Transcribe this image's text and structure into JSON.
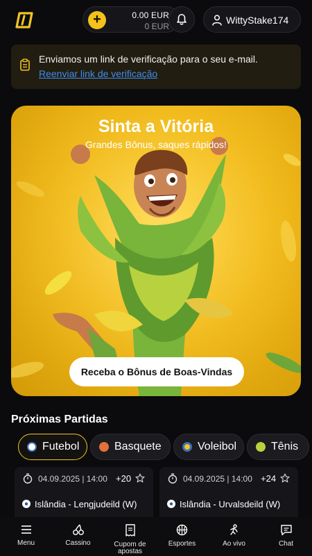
{
  "header": {
    "balance_main": "0.00 EUR",
    "balance_sub": "0 EUR",
    "coin_symbol": "+",
    "username": "WittyStake174"
  },
  "verify": {
    "message": "Enviamos um link de verificação para o seu e-mail.",
    "link": "Reenviar link de verificação"
  },
  "hero": {
    "title": "Sinta a Vitória",
    "subtitle": "Grandes Bônus, saques rápidos!",
    "cta": "Receba o Bônus de Boas-Vindas"
  },
  "matches": {
    "title": "Próximas Partidas",
    "sports": [
      {
        "label": "Futebol",
        "icon": "soccer-ball-icon",
        "active": true
      },
      {
        "label": "Basquete",
        "icon": "basketball-icon",
        "active": false
      },
      {
        "label": "Voleibol",
        "icon": "volleyball-icon",
        "active": false
      },
      {
        "label": "Tênis",
        "icon": "tennis-ball-icon",
        "active": false
      }
    ],
    "cards": [
      {
        "time": "04.09.2025 | 14:00",
        "more": "+20",
        "league": "Islândia - Lengjudeild (W)"
      },
      {
        "time": "04.09.2025 | 14:00",
        "more": "+24",
        "league": "Islândia - Urvalsdeild (W)"
      }
    ]
  },
  "nav": [
    {
      "label": "Menu",
      "icon": "menu-icon"
    },
    {
      "label": "Cassino",
      "icon": "cherries-icon"
    },
    {
      "label": "Cupom de apostas",
      "icon": "coupon-icon"
    },
    {
      "label": "Esportes",
      "icon": "basketball-icon"
    },
    {
      "label": "Ao vivo",
      "icon": "live-runner-icon"
    },
    {
      "label": "Chat",
      "icon": "chat-icon"
    }
  ],
  "colors": {
    "accent": "#f2c425",
    "background": "#0b0b0d",
    "link": "#3d8ef0",
    "banner_bg": "#221d11"
  }
}
